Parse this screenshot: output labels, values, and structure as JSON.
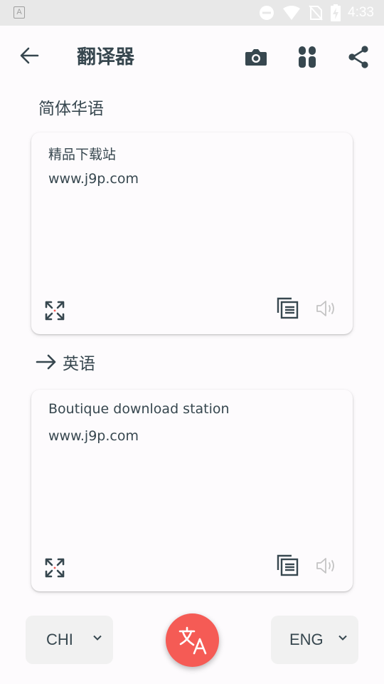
{
  "status_bar": {
    "app_badge": "A",
    "time": "4:33",
    "icons": [
      "do-not-disturb-icon",
      "wifi-icon",
      "no-sim-icon",
      "battery-charging-icon"
    ]
  },
  "toolbar": {
    "title": "翻译器",
    "icons": [
      "back-arrow-icon",
      "camera-icon",
      "grid-icon",
      "share-icon"
    ]
  },
  "source": {
    "language_label": "简体华语",
    "text_line1": "精品下载站",
    "text_line2": "www.j9p.com"
  },
  "target": {
    "language_label": "英语",
    "text_line1": "Boutique download station",
    "text_line2": "www.j9p.com"
  },
  "bottom_bar": {
    "source_code": "CHI",
    "target_code": "ENG"
  },
  "colors": {
    "accent": "#f55b55",
    "text": "#37474f",
    "background": "#fdfbfd",
    "status_bar": "#e8e8e8"
  }
}
